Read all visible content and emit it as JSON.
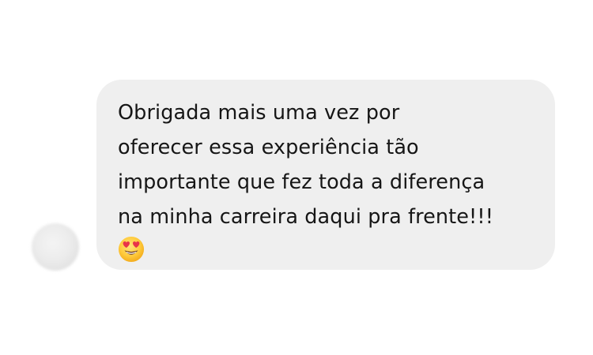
{
  "message": {
    "lines": [
      "Obrigada mais uma vez por",
      "oferecer essa experiência tão",
      "importante que fez toda a diferença",
      "na minha carreira daqui pra frente!!!"
    ],
    "emoji": "heart-eyes-emoji"
  },
  "colors": {
    "bubble": "#efefef",
    "text": "#161616",
    "background": "#ffffff"
  }
}
